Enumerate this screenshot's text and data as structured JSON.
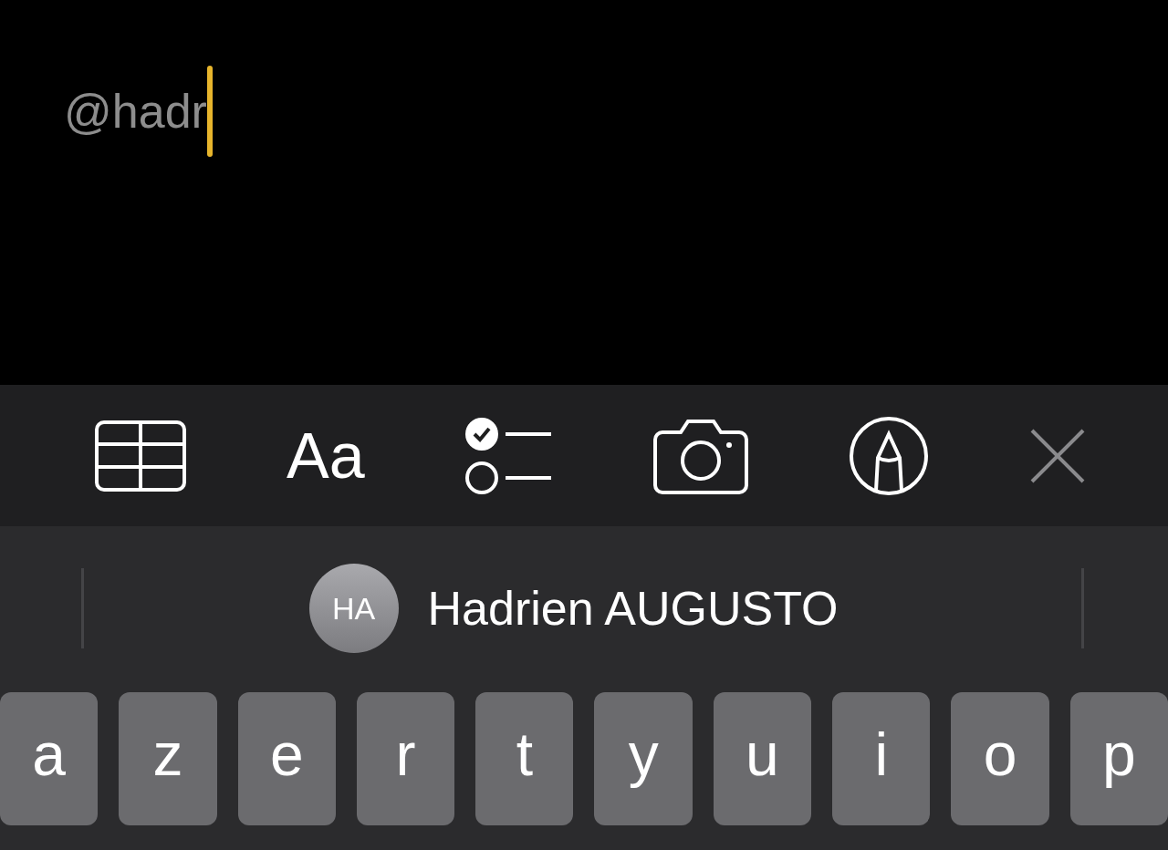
{
  "note": {
    "text": "@hadr"
  },
  "toolbar": [
    {
      "kind": "table"
    },
    {
      "kind": "format",
      "label": "Aa"
    },
    {
      "kind": "checklist"
    },
    {
      "kind": "camera"
    },
    {
      "kind": "markup"
    },
    {
      "kind": "close"
    }
  ],
  "mention_suggestion": {
    "initials": "HA",
    "name": "Hadrien AUGUSTO"
  },
  "keys": [
    "a",
    "z",
    "e",
    "r",
    "t",
    "y",
    "u",
    "i",
    "o",
    "p"
  ]
}
